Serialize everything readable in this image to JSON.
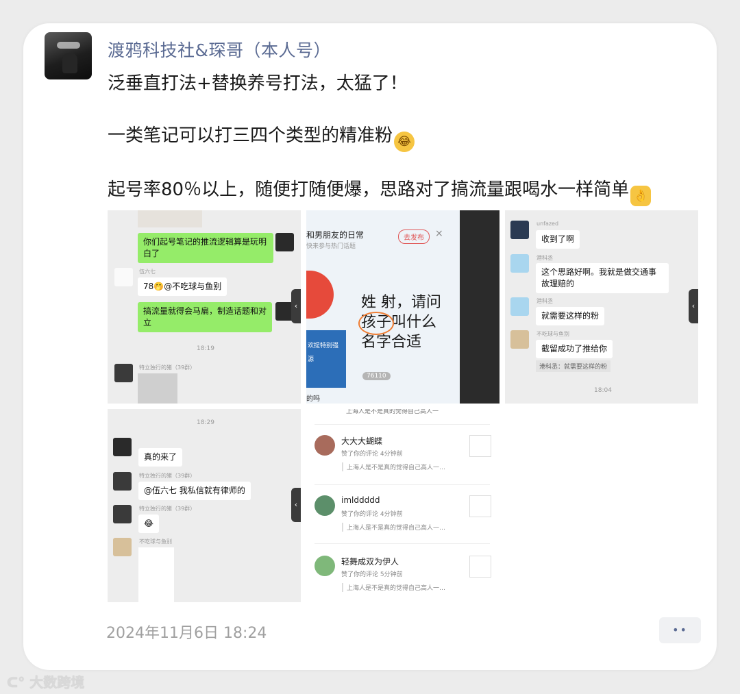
{
  "author": "渡鸦科技社&琛哥（本人号）",
  "post": {
    "line1": "泛垂直打法+替换养号打法，太猛了！",
    "line2": "一类笔记可以打三四个类型的精准粉",
    "line3": "起号率80％以上，随便打随便爆，思路对了搞流量跟喝水一样简单",
    "emoji1": "facepalm-emoji",
    "emoji2": "ok-hand-emoji"
  },
  "shot1": {
    "msg1": "你们起号笔记的推流逻辑算是玩明白了",
    "name1": "伍六七",
    "msg2": "78🤭@不吃球与鱼别",
    "msg3": "搞流量就得会马扁，制造话题和对立",
    "time": "18:19",
    "name2": "特立独行的猪（39群）"
  },
  "shot2": {
    "header": "和男朋友的日常",
    "sub": "快来参与热门话题",
    "publish": "去发布",
    "close": "×",
    "line1": "姓 射，请问",
    "line2": "孩子叫什么",
    "line3": "名字合适",
    "views": "76110",
    "blue": "欢提特别强",
    "blue2": "源",
    "footer": "的吗"
  },
  "shot3": {
    "name1": "unfazed",
    "msg1": "收到了啊",
    "name2": "港科丞",
    "msg2": "这个思路好啊。我就是做交通事故理赔的",
    "name3": "港科丞",
    "msg3": "就需要这样的粉",
    "name4": "不吃球与鱼别",
    "msg4": "截留成功了推给你",
    "quote": "港科丞：就需要这样的粉",
    "time": "18:04"
  },
  "shot4": {
    "time": "18:29",
    "msg1": "真的来了",
    "name1": "特立独行的猪（39群）",
    "msg2": "@伍六七 我私信就有律师的",
    "name2": "特立独行的猪（39群）",
    "emoji": "😂",
    "name3": "不吃球与鱼别"
  },
  "shot5": {
    "top": "上海人是不是真的觉得自己高人一",
    "items": [
      {
        "name": "大大大蝴蝶",
        "action": "赞了你的评论",
        "time": "4分钟前",
        "quote": "上海人是不是真的觉得自己高人一…"
      },
      {
        "name": "imlddddd",
        "action": "赞了你的评论",
        "time": "4分钟前",
        "quote": "上海人是不是真的觉得自己高人一…"
      },
      {
        "name": "轻舞成双为伊人",
        "action": "赞了你的评论",
        "time": "5分钟前",
        "quote": "上海人是不是真的觉得自己高人一…"
      }
    ]
  },
  "date": "2024年11月6日 18:24",
  "more": "••",
  "watermark": "大数跨境"
}
